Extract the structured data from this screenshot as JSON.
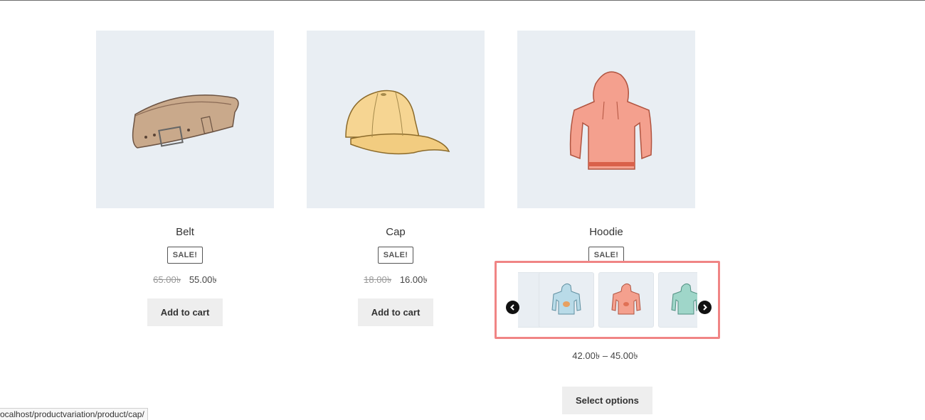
{
  "products": [
    {
      "title": "Belt",
      "badge": "SALE!",
      "old_price": "65.00৳",
      "new_price": "55.00৳",
      "button": "Add to cart"
    },
    {
      "title": "Cap",
      "badge": "SALE!",
      "old_price": "18.00৳",
      "new_price": "16.00৳",
      "button": "Add to cart"
    },
    {
      "title": "Hoodie",
      "badge": "SALE!",
      "price_range": "42.00৳  – 45.00৳",
      "button": "Select options"
    }
  ],
  "gallery": {
    "tiles": [
      {
        "icon": "hoodie-blue-icon",
        "color": "#b9dbe8"
      },
      {
        "icon": "hoodie-pink-icon",
        "color": "#f4a08e"
      },
      {
        "icon": "hoodie-green-icon",
        "color": "#9fd6c9"
      }
    ],
    "highlight_color": "#f08585"
  },
  "status_bar": {
    "url": "ocalhost/productvariation/product/cap/"
  }
}
